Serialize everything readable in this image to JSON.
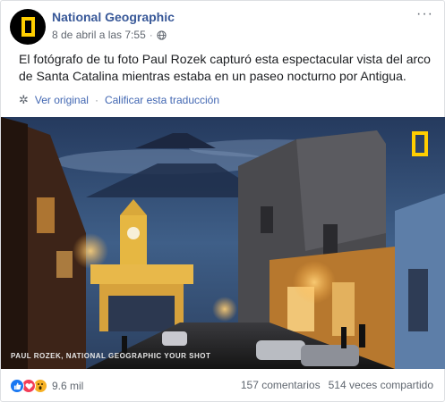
{
  "post": {
    "page_name": "National Geographic",
    "timestamp": "8 de abril a las 7:55",
    "text": "El fotógrafo de tu foto Paul Rozek capturó esta espectacular vista del arco de Santa Catalina mientras estaba en un paseo nocturno por Antigua.",
    "see_original": "Ver original",
    "rate_translation": "Calificar esta traducción",
    "separator": "·",
    "photo_credit": "PAUL ROZEK, NATIONAL GEOGRAPHIC YOUR SHOT"
  },
  "footer": {
    "reaction_count": "9.6 mil",
    "comments": "157 comentarios",
    "shares": "514 veces compartido"
  },
  "colors": {
    "link_blue": "#385898",
    "ng_yellow": "#ffce00"
  },
  "icons": [
    "globe-icon",
    "more-options-icon",
    "gear-icon",
    "like-icon",
    "love-icon",
    "wow-icon"
  ]
}
